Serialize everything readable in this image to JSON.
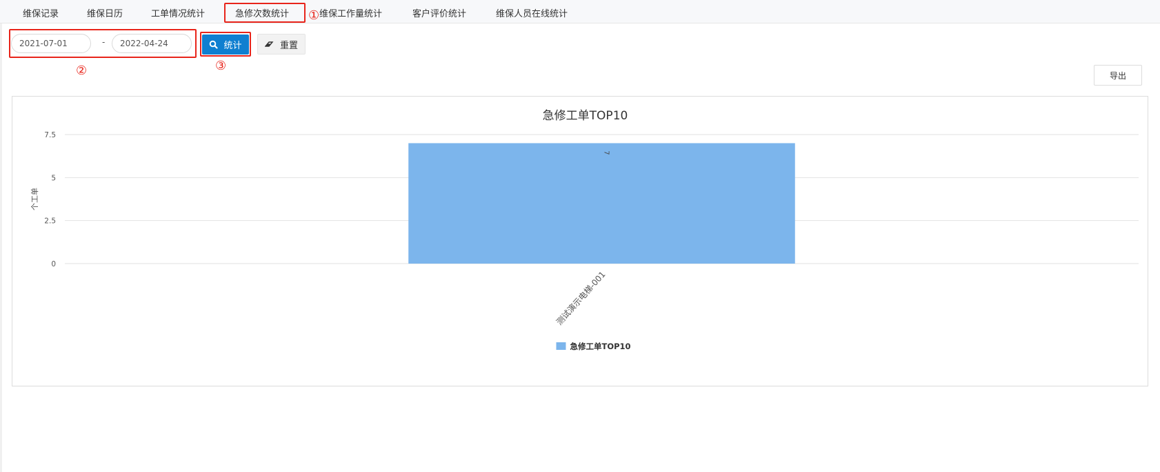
{
  "tabs": [
    {
      "label": "维保记录"
    },
    {
      "label": "维保日历"
    },
    {
      "label": "工单情况统计"
    },
    {
      "label": "急修次数统计"
    },
    {
      "label": "维保工作量统计"
    },
    {
      "label": "客户评价统计"
    },
    {
      "label": "维保人员在线统计"
    }
  ],
  "active_tab": "急修次数统计",
  "annotations": {
    "m1": "①",
    "m2": "②",
    "m3": "③",
    "color": "#e8241a"
  },
  "filters": {
    "start_date": "2021-07-01",
    "separator": "-",
    "end_date": "2022-04-24"
  },
  "buttons": {
    "stat_label": "统计",
    "stat_icon": "search-icon",
    "reset_label": "重置",
    "reset_icon": "eraser-icon",
    "export_label": "导出"
  },
  "colors": {
    "primary": "#0f7fd0",
    "bar": "#7cb5ec",
    "highlight": "#e8241a"
  },
  "chart_data": {
    "type": "bar",
    "title": "急修工单TOP10",
    "ylabel": "个工单",
    "xlabel": "",
    "categories": [
      "测试演示电梯-001"
    ],
    "series": [
      {
        "name": "急修工单TOP10",
        "values": [
          7
        ]
      }
    ],
    "data_labels": [
      "7"
    ],
    "ylim": [
      0,
      7.5
    ],
    "yticks": [
      "0",
      "2.5",
      "5",
      "7.5"
    ],
    "ytick_values": [
      0,
      2.5,
      5,
      7.5
    ],
    "grid": true,
    "legend": "bottom-center",
    "bar_color": "#7cb5ec"
  }
}
